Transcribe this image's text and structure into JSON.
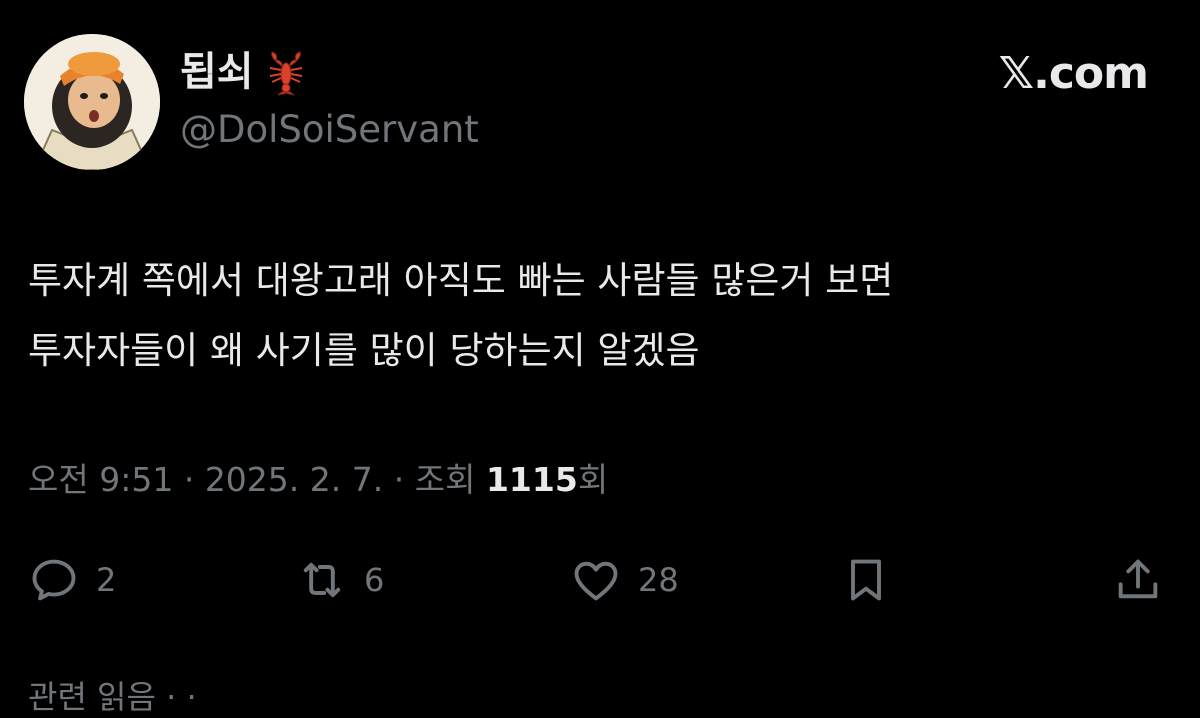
{
  "author": {
    "display_name": "됩쇠",
    "name_emoji": "lobster-icon",
    "handle": "@DolSoiServant"
  },
  "brand": "𝕏.com",
  "tweet": {
    "lines": [
      "투자계 쪽에서 대왕고래 아직도 빠는 사람들 많은거 보면",
      "투자자들이 왜 사기를 많이 당하는지 알겠음"
    ]
  },
  "meta": {
    "time": "오전 9:51",
    "separator": " · ",
    "date": "2025. 2. 7.",
    "views_prefix": "조회 ",
    "views_count": "1115",
    "views_suffix": "회"
  },
  "actions": {
    "reply_count": "2",
    "retweet_count": "6",
    "like_count": "28"
  },
  "related_label": "관련 읽음 · ·",
  "colors": {
    "background": "#000000",
    "text_primary": "#e7e9ea",
    "text_secondary": "#71767b"
  }
}
